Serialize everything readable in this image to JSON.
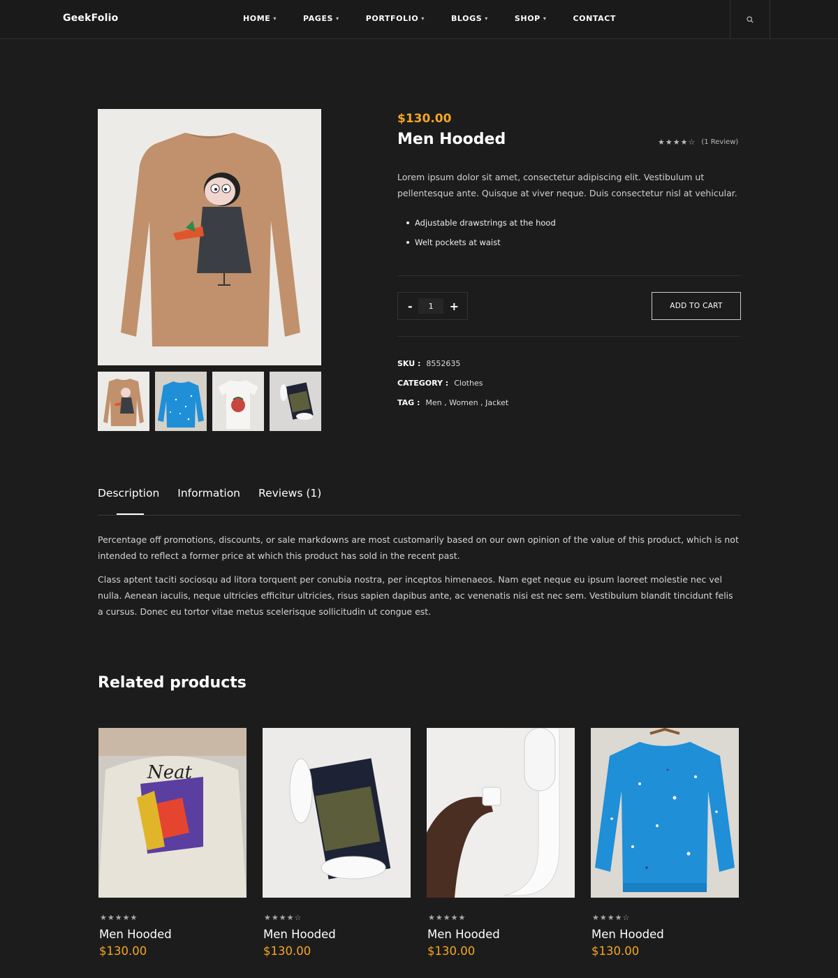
{
  "header": {
    "logo": "GeekFolio",
    "nav": [
      {
        "label": "HOME",
        "caret": "▾"
      },
      {
        "label": "PAGES",
        "caret": "▾"
      },
      {
        "label": "PORTFOLIO",
        "caret": "▾"
      },
      {
        "label": "BLOGS",
        "caret": "▾"
      },
      {
        "label": "SHOP",
        "caret": "▾"
      },
      {
        "label": "CONTACT",
        "caret": ""
      }
    ],
    "search_icon": "search-icon"
  },
  "product": {
    "price": "$130.00",
    "title": "Men Hooded",
    "stars": "★★★★☆",
    "rating": 4,
    "review_count": "(1 Review)",
    "short_description": "Lorem ipsum dolor sit amet, consectetur adipiscing elit. Vestibulum ut pellentesque ante. Quisque at viver neque. Duis consectetur nisl at vehicular.",
    "features": [
      "Adjustable drawstrings at the hood",
      "Welt pockets at waist"
    ],
    "quantity": {
      "minus": "-",
      "value": "1",
      "plus": "+"
    },
    "add_to_cart": "ADD TO CART",
    "meta": {
      "sku_label": "SKU :",
      "sku": "8552635",
      "category_label": "CATEGORY :",
      "category": "Clothes",
      "tag_label": "TAG :",
      "tags": [
        "Men",
        "Women",
        "Jacket"
      ]
    }
  },
  "tabs": {
    "items": [
      "Description",
      "Information",
      "Reviews (1)"
    ],
    "active": "Description",
    "description": [
      "Percentage off promotions, discounts, or sale markdowns are most customarily based on our own opinion of the value of this product, which is not intended to reflect a former price at which this product has sold in the recent past.",
      "Class aptent taciti sociosqu ad litora torquent per conubia nostra, per inceptos himenaeos. Nam eget neque eu ipsum laoreet molestie nec vel nulla. Aenean iaculis, neque ultricies efficitur ultricies, risus sapien dapibus ante, ac venenatis nisi est nec sem. Vestibulum blandit tincidunt felis a cursus. Donec eu tortor vitae metus scelerisque sollicitudin ut congue est."
    ]
  },
  "related": {
    "title": "Related products",
    "items": [
      {
        "stars": "★★★★★",
        "rating": 5,
        "title": "Men Hooded",
        "price": "$130.00"
      },
      {
        "stars": "★★★★☆",
        "rating": 4,
        "title": "Men Hooded",
        "price": "$130.00"
      },
      {
        "stars": "★★★★★",
        "rating": 5,
        "title": "Men Hooded",
        "price": "$130.00"
      },
      {
        "stars": "★★★★☆",
        "rating": 4,
        "title": "Men Hooded",
        "price": "$130.00"
      }
    ]
  },
  "colors": {
    "accent": "#f5a623",
    "background": "#1c1c1c"
  }
}
